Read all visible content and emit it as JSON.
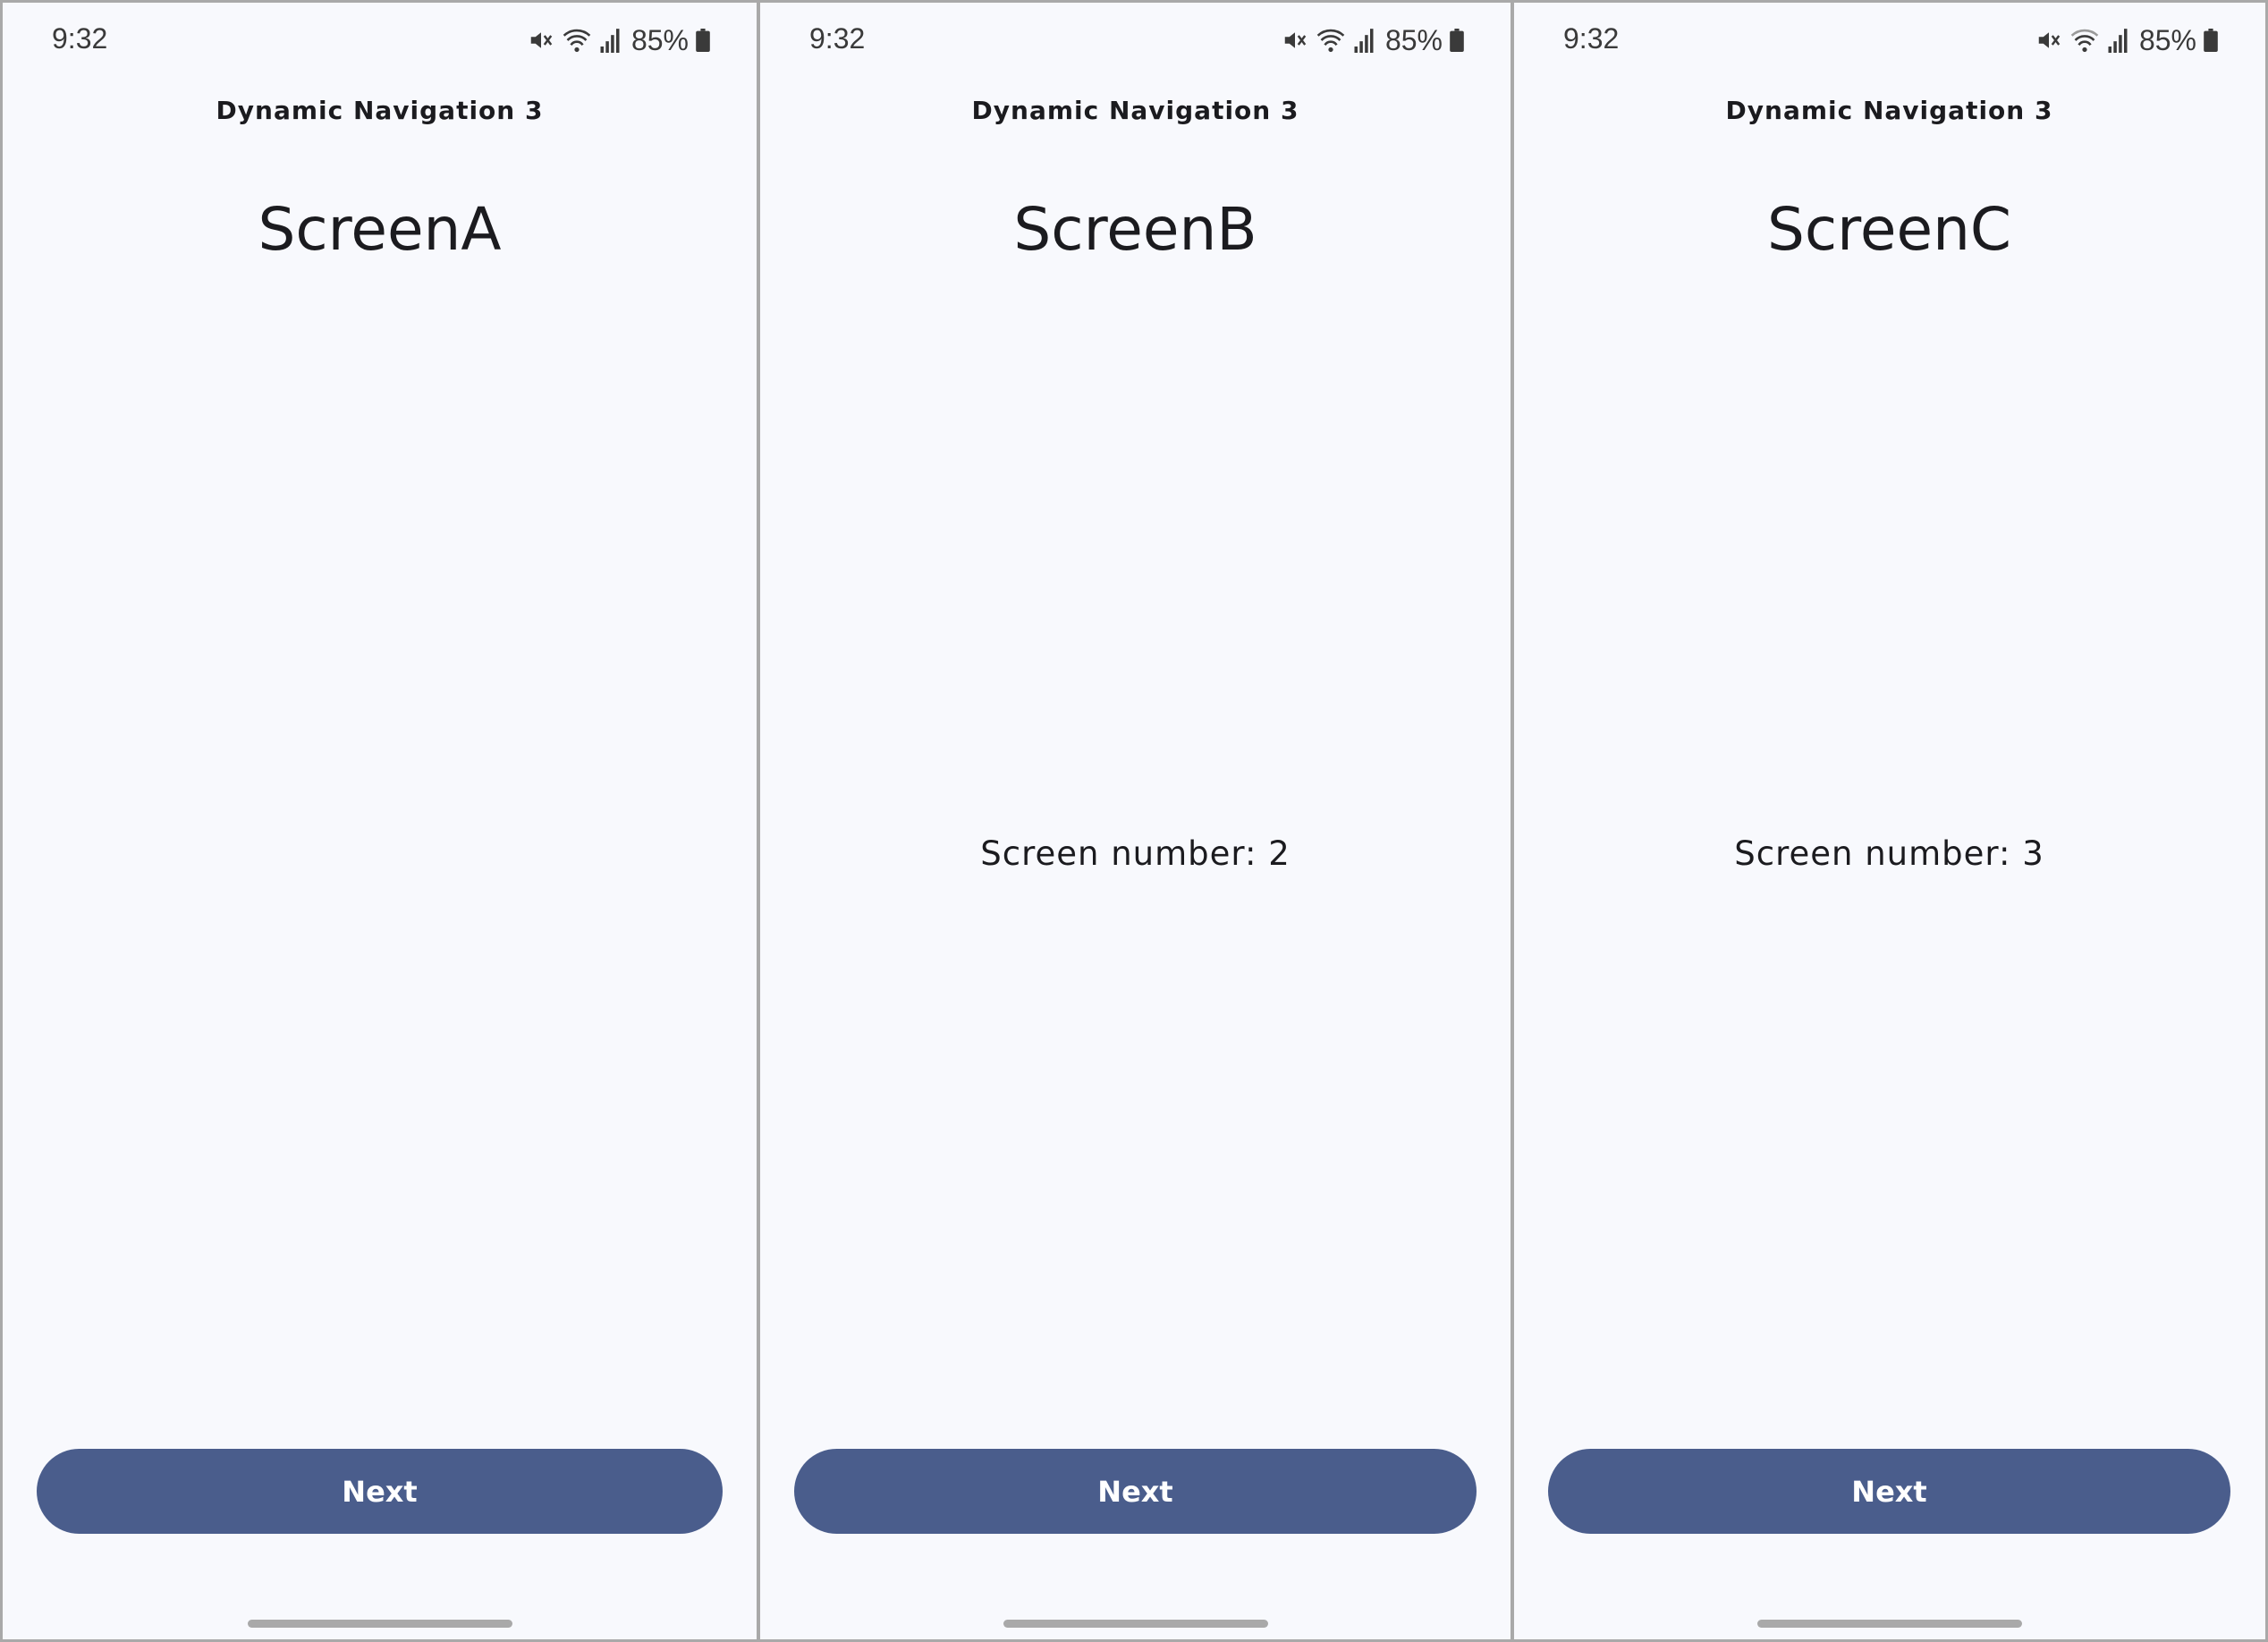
{
  "screens": [
    {
      "status": {
        "time": "9:32",
        "battery": "85%"
      },
      "app_title": "Dynamic Navigation 3",
      "heading": "ScreenA",
      "screen_number": "",
      "next_label": "Next"
    },
    {
      "status": {
        "time": "9:32",
        "battery": "85%"
      },
      "app_title": "Dynamic Navigation 3",
      "heading": "ScreenB",
      "screen_number": "Screen number: 2",
      "next_label": "Next"
    },
    {
      "status": {
        "time": "9:32",
        "battery": "85%"
      },
      "app_title": "Dynamic Navigation 3",
      "heading": "ScreenC",
      "screen_number": "Screen number: 3",
      "next_label": "Next"
    }
  ],
  "icons": {
    "mute": "mute-icon",
    "wifi": "wifi-icon",
    "signal": "signal-icon",
    "battery": "battery-icon"
  },
  "colors": {
    "button": "#4a5d8c",
    "button_text": "#ffffff",
    "background": "#f8f9fd",
    "divider": "#a9a9a9"
  }
}
